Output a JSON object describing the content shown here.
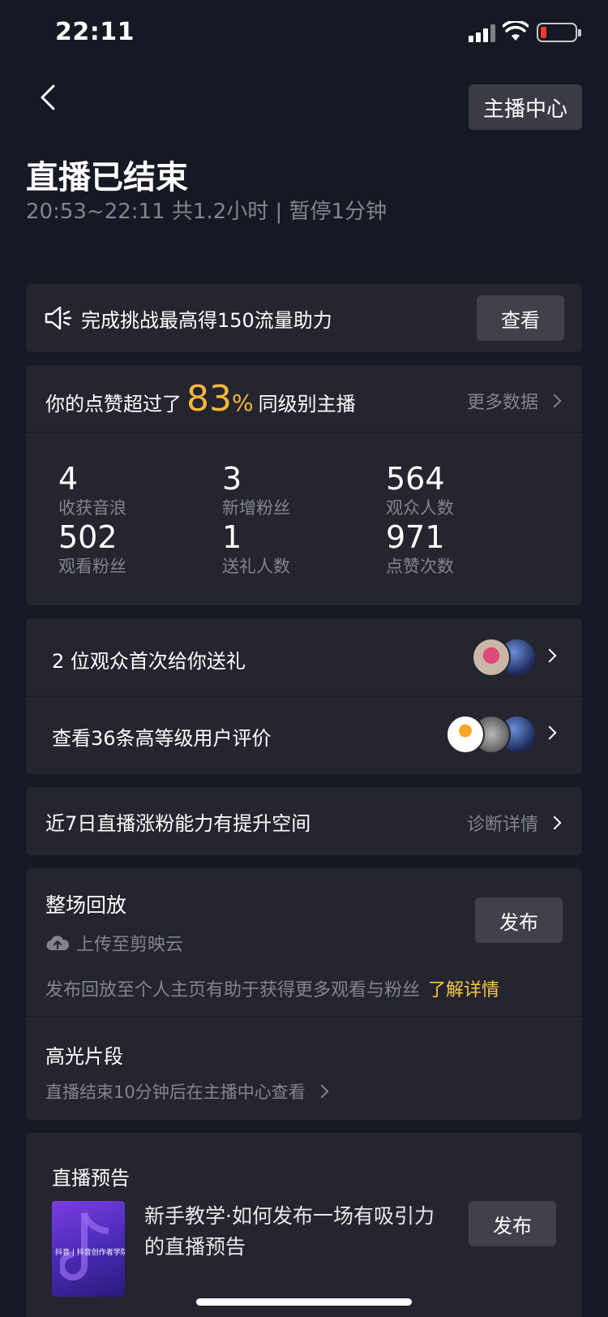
{
  "status_bar": {
    "time": "22:11"
  },
  "header": {
    "back_icon": "chevron-left-icon",
    "anchor_center_label": "主播中心",
    "title": "直播已结束",
    "subtitle": "20:53~22:11 共1.2小时 | 暂停1分钟"
  },
  "challenge": {
    "icon": "speaker-icon",
    "text": "完成挑战最高得150流量助力",
    "button_label": "查看"
  },
  "stats": {
    "likes_prefix": "你的点赞超过了",
    "likes_percent": "83",
    "likes_percent_sign": "%",
    "likes_suffix": "同级别主播",
    "more_data_label": "更多数据",
    "items": [
      {
        "value": "4",
        "label": "收获音浪"
      },
      {
        "value": "3",
        "label": "新增粉丝"
      },
      {
        "value": "564",
        "label": "观众人数"
      },
      {
        "value": "502",
        "label": "观看粉丝"
      },
      {
        "value": "1",
        "label": "送礼人数"
      },
      {
        "value": "971",
        "label": "点赞次数"
      }
    ]
  },
  "gift_rows": [
    {
      "text": "2 位观众首次给你送礼"
    },
    {
      "text": "查看36条高等级用户评价"
    }
  ],
  "growth": {
    "text": "近7日直播涨粉能力有提升空间",
    "link_label": "诊断详情"
  },
  "replay": {
    "title": "整场回放",
    "upload_label": "上传至剪映云",
    "publish_label": "发布",
    "desc": "发布回放至个人主页有助于获得更多观看与粉丝",
    "learn_more": "了解详情",
    "highlight_title": "高光片段",
    "highlight_desc": "直播结束10分钟后在主播中心查看"
  },
  "preview": {
    "title": "直播预告",
    "thumb_text": "抖音 | 抖音创作者学院",
    "text": "新手教学·如何发布一场有吸引力的直播预告",
    "publish_label": "发布"
  },
  "colors": {
    "background": "#161823",
    "card": "#24252e",
    "accent_gold": "#f6b73c",
    "link_yellow": "#f6c944"
  }
}
